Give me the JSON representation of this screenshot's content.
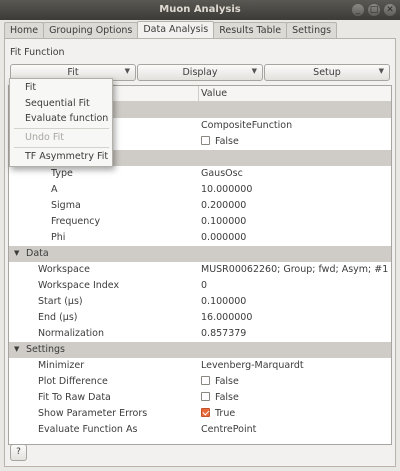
{
  "window": {
    "title": "Muon Analysis",
    "min_glyph": "_",
    "max_glyph": "□",
    "close_glyph": "✕"
  },
  "tabs": [
    {
      "label": "Home"
    },
    {
      "label": "Grouping Options"
    },
    {
      "label": "Data Analysis",
      "active": true
    },
    {
      "label": "Results Table"
    },
    {
      "label": "Settings"
    }
  ],
  "fit_function_label": "Fit Function",
  "toolbar": {
    "fit": "Fit",
    "display": "Display",
    "setup": "Setup",
    "arrow": "▼"
  },
  "fit_menu": {
    "items": [
      "Fit",
      "Sequential Fit",
      "Evaluate function",
      "Undo Fit",
      "TF Asymmetry Fit"
    ],
    "disabled": [
      "Undo Fit"
    ]
  },
  "tree": {
    "header": {
      "value": "Value"
    },
    "function": {
      "composite_value": "CompositeFunction",
      "flag_value": "False",
      "type_label": "Type",
      "type_value": "GausOsc",
      "params": [
        {
          "name": "A",
          "value": "10.000000"
        },
        {
          "name": "Sigma",
          "value": "0.200000"
        },
        {
          "name": "Frequency",
          "value": "0.100000"
        },
        {
          "name": "Phi",
          "value": "0.000000"
        }
      ]
    },
    "data": {
      "label": "Data",
      "rows": [
        {
          "name": "Workspace",
          "value": "MUSR00062260; Group; fwd; Asym; #1"
        },
        {
          "name": "Workspace Index",
          "value": "0"
        },
        {
          "name": "Start (μs)",
          "value": "0.100000"
        },
        {
          "name": "End (μs)",
          "value": "16.000000"
        },
        {
          "name": "Normalization",
          "value": "0.857379"
        }
      ]
    },
    "settings": {
      "label": "Settings",
      "minimizer": {
        "name": "Minimizer",
        "value": "Levenberg-Marquardt"
      },
      "plot_difference": {
        "name": "Plot Difference",
        "value": "False",
        "checked": false
      },
      "fit_to_raw": {
        "name": "Fit To Raw Data",
        "value": "False",
        "checked": false
      },
      "show_errors": {
        "name": "Show Parameter Errors",
        "value": "True",
        "checked": true
      },
      "evaluate_as": {
        "name": "Evaluate Function As",
        "value": "CentrePoint"
      }
    },
    "expand_glyph": "▼"
  },
  "help_button": {
    "label": "?"
  },
  "colors": {
    "accent": "#e86a3a",
    "group_row": "#cfccc7",
    "titlebar": "#3c3b37"
  }
}
